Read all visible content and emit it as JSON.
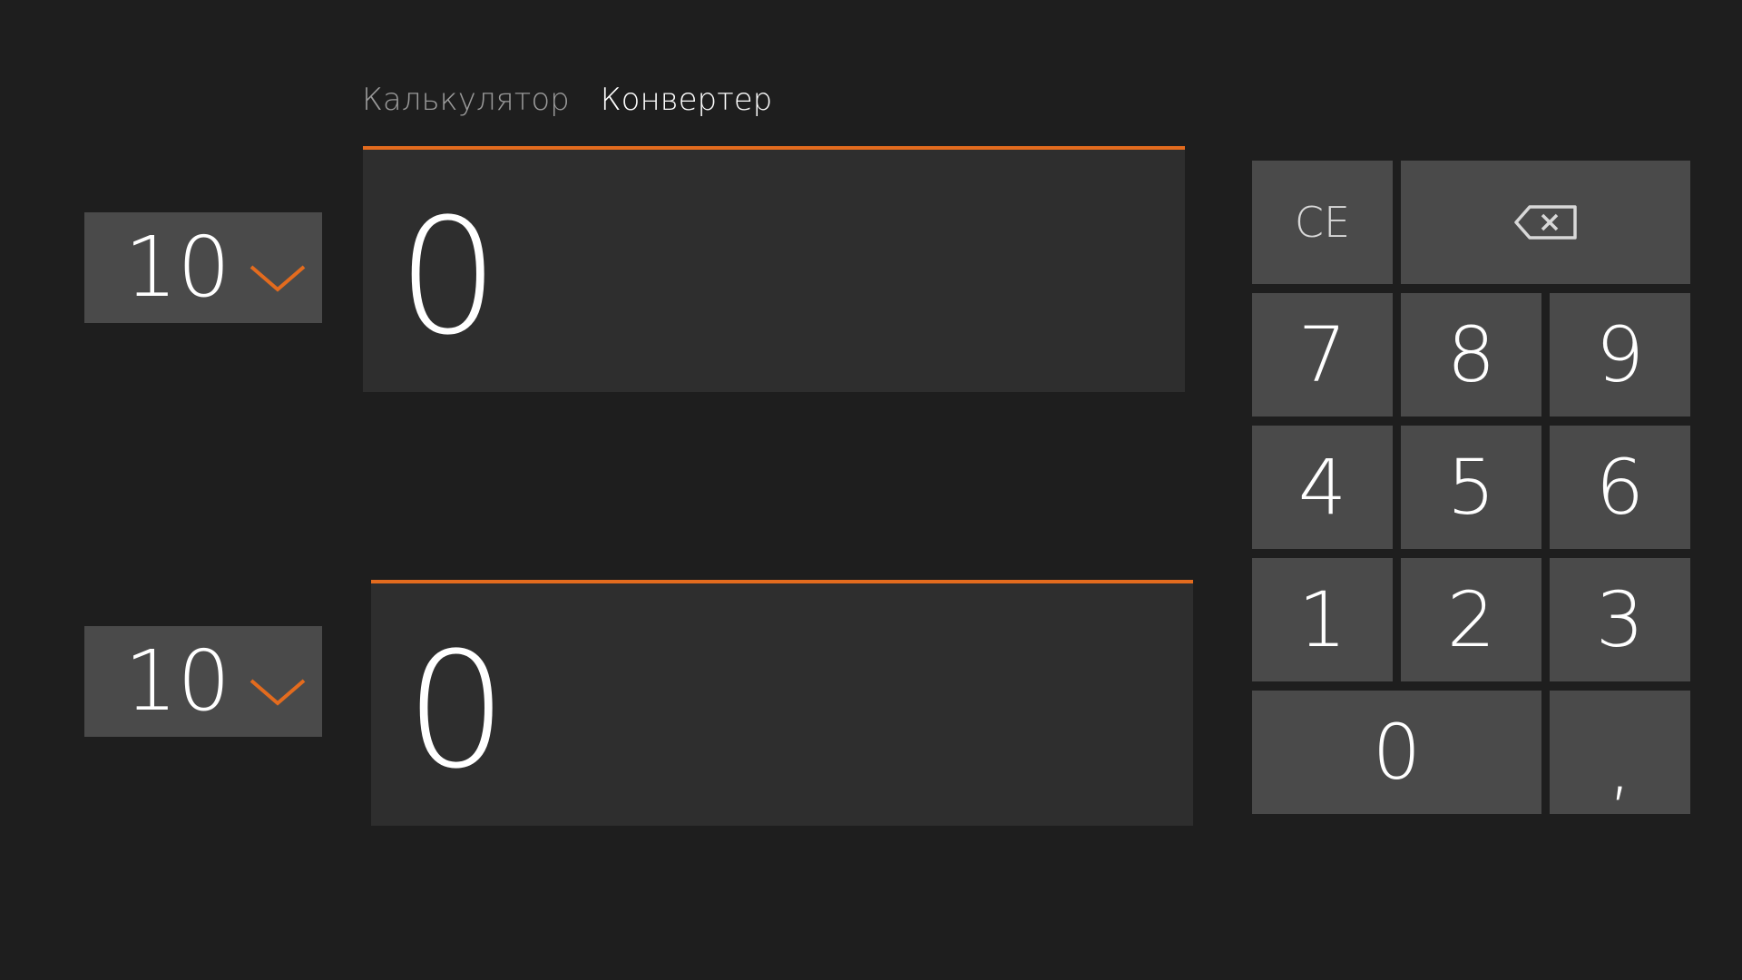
{
  "tabs": [
    {
      "label": "Калькулятор",
      "active": false
    },
    {
      "label": "Конвертер",
      "active": true
    }
  ],
  "converter": {
    "top": {
      "base": "10",
      "value": "0"
    },
    "bottom": {
      "base": "10",
      "value": "0"
    }
  },
  "keypad": {
    "ce": "CE",
    "backspace_icon": "backspace-icon",
    "k7": "7",
    "k8": "8",
    "k9": "9",
    "k4": "4",
    "k5": "5",
    "k6": "6",
    "k1": "1",
    "k2": "2",
    "k3": "3",
    "k0": "0",
    "decimal": ","
  },
  "colors": {
    "background": "#1e1e1e",
    "field": "#2e2e2e",
    "key": "#4a4a4a",
    "accent": "#e36b1e",
    "tab_inactive": "#9a9a9a"
  }
}
